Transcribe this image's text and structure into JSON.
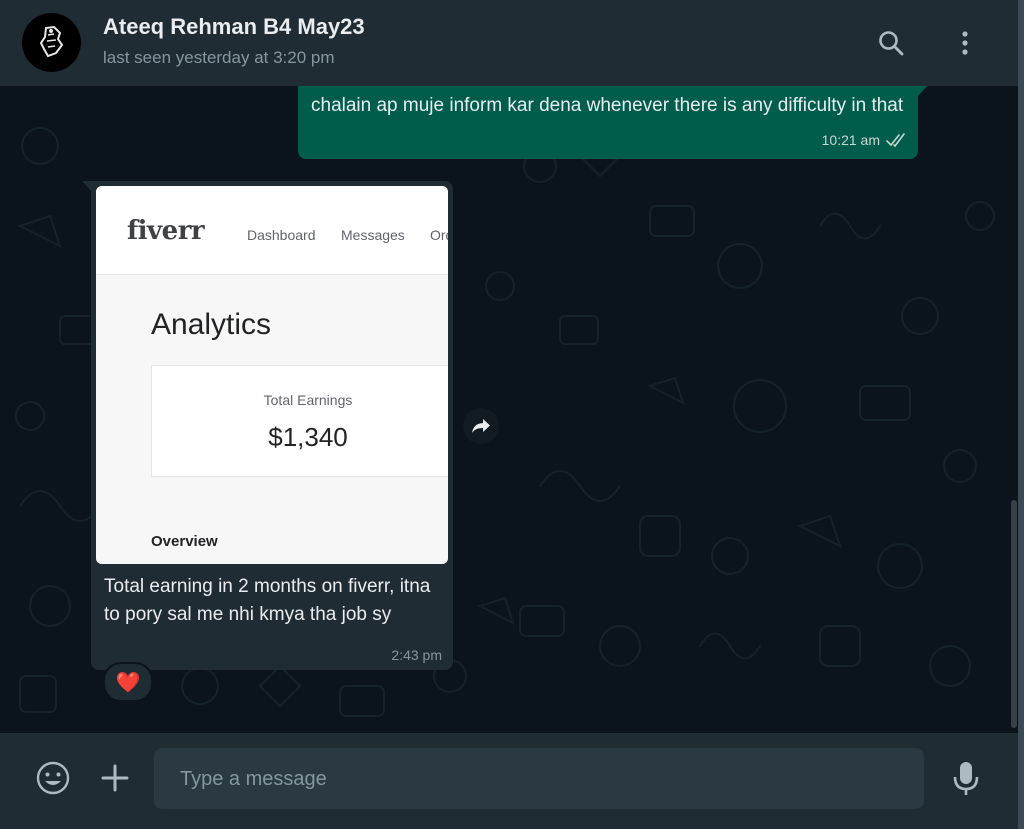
{
  "header": {
    "contact_name": "Ateeq Rehman B4 May23",
    "last_seen": "last seen yesterday at 3:20 pm",
    "search_icon": "search-icon",
    "menu_icon": "kebab-menu-icon"
  },
  "messages": [
    {
      "direction": "outgoing",
      "text": "chalain ap muje inform kar dena whenever there is any difficulty in that",
      "time": "10:21 am",
      "status": "read"
    },
    {
      "direction": "incoming",
      "image": {
        "logo": "fiverr",
        "nav": [
          "Dashboard",
          "Messages",
          "Ord"
        ],
        "title": "Analytics",
        "card_label": "Total Earnings",
        "card_value": "$1,340",
        "section": "Overview"
      },
      "caption": "Total earning in 2 months on fiverr, itna to pory sal me nhi kmya tha job sy",
      "time": "2:43 pm",
      "reaction": "❤️"
    }
  ],
  "composer": {
    "placeholder": "Type a message",
    "emoji_icon": "emoji-icon",
    "attach_icon": "plus-icon",
    "mic_icon": "mic-icon"
  },
  "colors": {
    "header_bg": "#202c33",
    "chat_bg": "#0b141a",
    "outgoing_bubble": "#005c4b",
    "incoming_bubble": "#202c33"
  }
}
